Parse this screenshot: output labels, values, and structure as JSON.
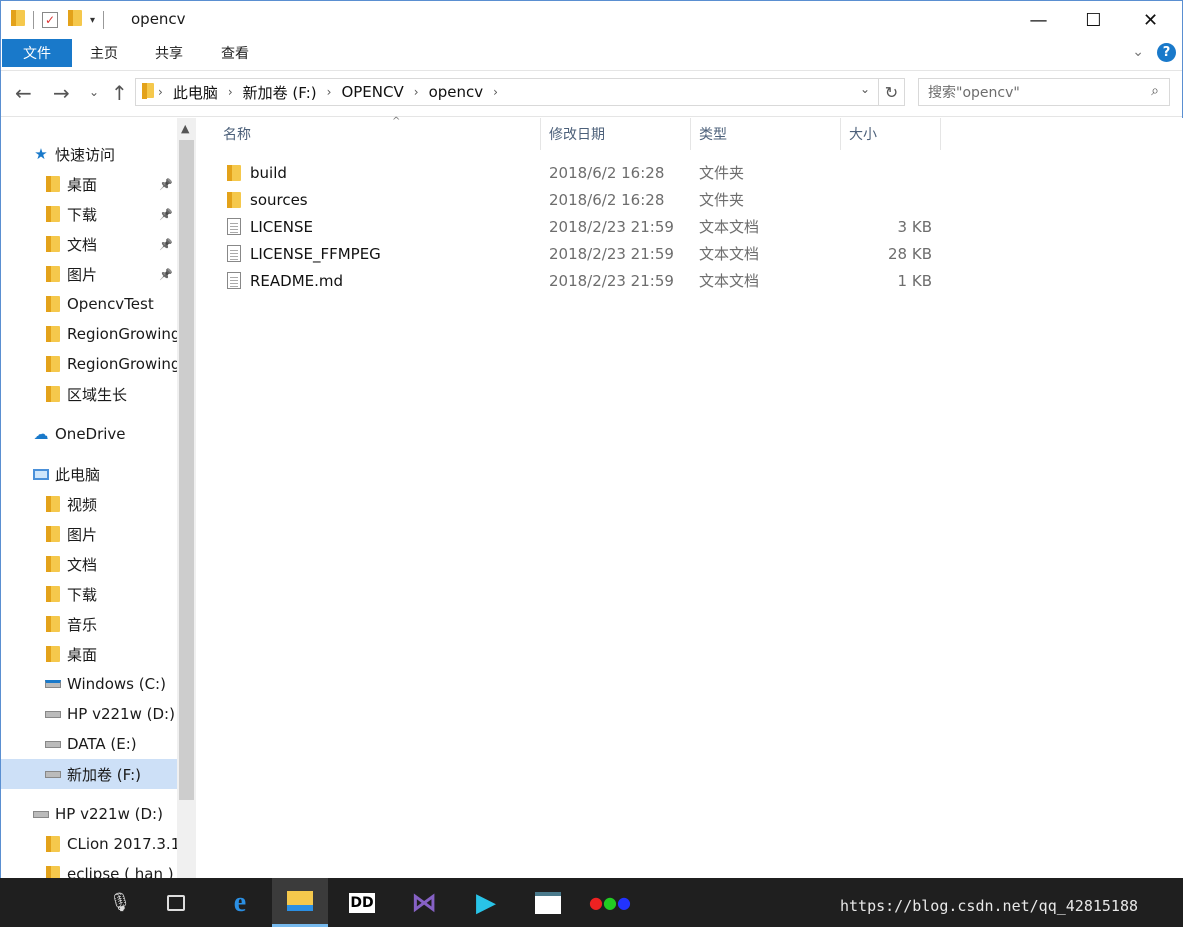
{
  "window": {
    "title": "opencv"
  },
  "ribbon": {
    "tabs": [
      "文件",
      "主页",
      "共享",
      "查看"
    ]
  },
  "address": {
    "crumbs": [
      "此电脑",
      "新加卷 (F:)",
      "OPENCV",
      "opencv"
    ],
    "search_placeholder": "搜索\"opencv\""
  },
  "sidebar": {
    "items": [
      {
        "label": "快速访问",
        "icon": "star-icon",
        "indent": 0
      },
      {
        "label": "桌面",
        "icon": "desktop-folder-icon",
        "indent": 1,
        "pinned": true
      },
      {
        "label": "下载",
        "icon": "downloads-folder-icon",
        "indent": 1,
        "pinned": true
      },
      {
        "label": "文档",
        "icon": "documents-folder-icon",
        "indent": 1,
        "pinned": true
      },
      {
        "label": "图片",
        "icon": "pictures-folder-icon",
        "indent": 1,
        "pinned": true
      },
      {
        "label": "OpencvTest",
        "icon": "folder-icon",
        "indent": 1
      },
      {
        "label": "RegionGrowing",
        "icon": "folder-icon",
        "indent": 1
      },
      {
        "label": "RegionGrowing",
        "icon": "folder-icon",
        "indent": 1
      },
      {
        "label": "区域生长",
        "icon": "folder-icon",
        "indent": 1
      },
      {
        "label": "OneDrive",
        "icon": "cloud-icon",
        "indent": 0
      },
      {
        "label": "此电脑",
        "icon": "computer-icon",
        "indent": 0
      },
      {
        "label": "视频",
        "icon": "videos-folder-icon",
        "indent": 1
      },
      {
        "label": "图片",
        "icon": "pictures-folder-icon",
        "indent": 1
      },
      {
        "label": "文档",
        "icon": "documents-folder-icon",
        "indent": 1
      },
      {
        "label": "下载",
        "icon": "downloads-folder-icon",
        "indent": 1
      },
      {
        "label": "音乐",
        "icon": "music-folder-icon",
        "indent": 1
      },
      {
        "label": "桌面",
        "icon": "desktop-folder-icon",
        "indent": 1
      },
      {
        "label": "Windows (C:)",
        "icon": "windows-drive-icon",
        "indent": 1
      },
      {
        "label": "HP v221w (D:)",
        "icon": "drive-icon",
        "indent": 1
      },
      {
        "label": "DATA (E:)",
        "icon": "drive-icon",
        "indent": 1
      },
      {
        "label": "新加卷 (F:)",
        "icon": "drive-icon",
        "indent": 1,
        "selected": true
      },
      {
        "label": "HP v221w (D:)",
        "icon": "drive-icon",
        "indent": 0
      },
      {
        "label": "CLion 2017.3.1",
        "icon": "folder-icon",
        "indent": 1
      },
      {
        "label": "eclipse ( han )",
        "icon": "folder-icon",
        "indent": 1
      }
    ]
  },
  "columns": [
    "名称",
    "修改日期",
    "类型",
    "大小"
  ],
  "files": [
    {
      "name": "build",
      "date": "2018/6/2 16:28",
      "type": "文件夹",
      "size": "",
      "kind": "folder"
    },
    {
      "name": "sources",
      "date": "2018/6/2 16:28",
      "type": "文件夹",
      "size": "",
      "kind": "folder"
    },
    {
      "name": "LICENSE",
      "date": "2018/2/23 21:59",
      "type": "文本文档",
      "size": "3 KB",
      "kind": "doc"
    },
    {
      "name": "LICENSE_FFMPEG",
      "date": "2018/2/23 21:59",
      "type": "文本文档",
      "size": "28 KB",
      "kind": "doc"
    },
    {
      "name": "README.md",
      "date": "2018/2/23 21:59",
      "type": "文本文档",
      "size": "1 KB",
      "kind": "doc"
    }
  ],
  "taskbar": {
    "items": [
      {
        "name": "microphone-icon"
      },
      {
        "name": "task-view-icon"
      },
      {
        "name": "edge-icon"
      },
      {
        "name": "file-explorer-icon",
        "active": true
      },
      {
        "name": "dolby-icon"
      },
      {
        "name": "visual-studio-icon"
      },
      {
        "name": "media-player-icon"
      },
      {
        "name": "app-window-icon"
      },
      {
        "name": "opencv-logo-icon"
      }
    ],
    "watermark": "https://blog.csdn.net/qq_42815188"
  }
}
